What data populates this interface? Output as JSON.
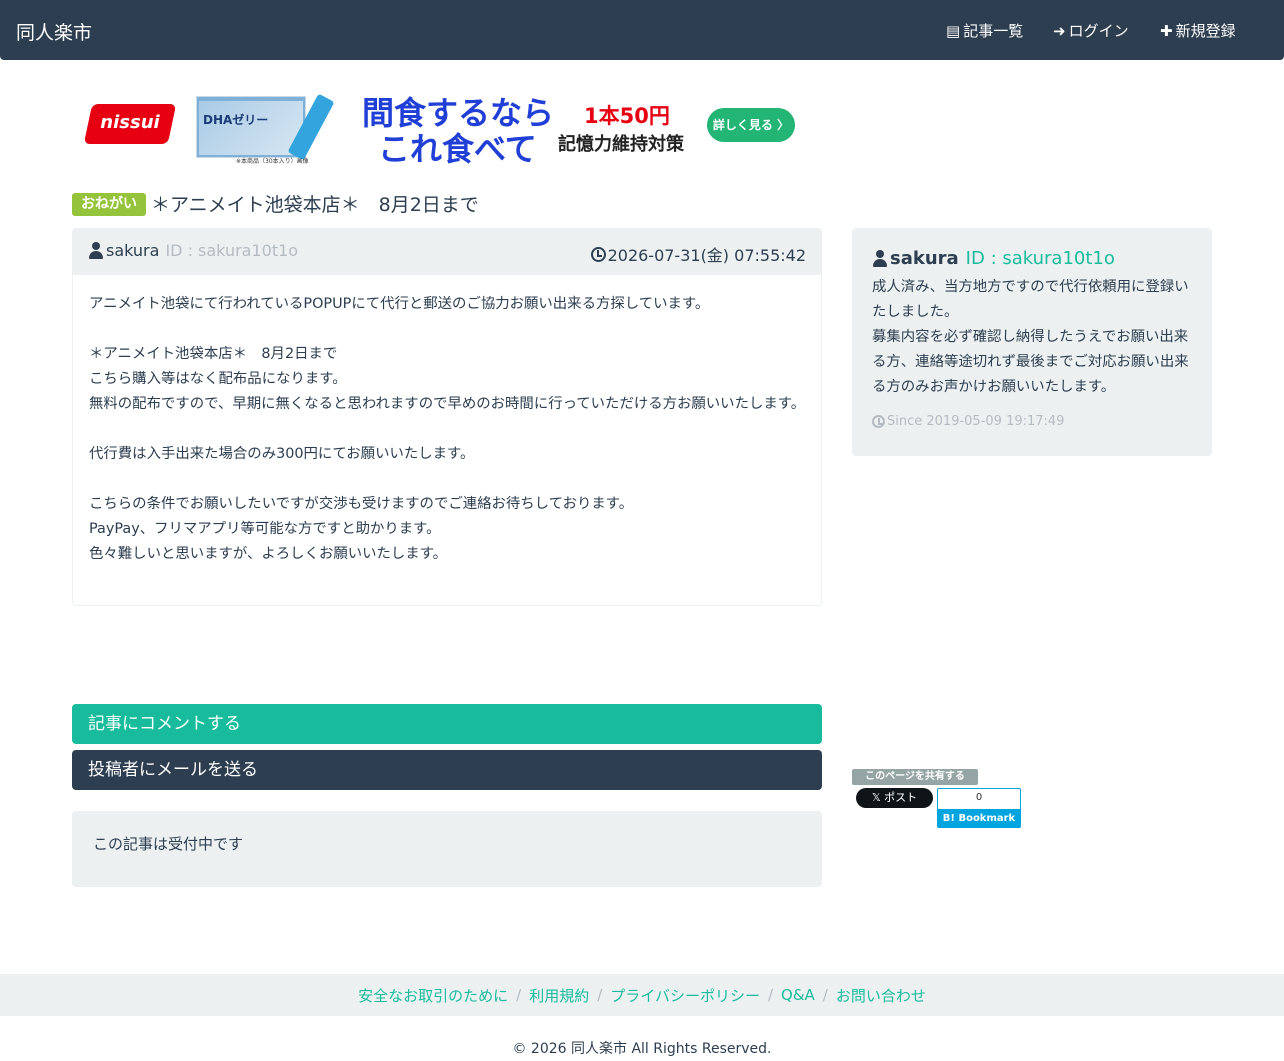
{
  "navbar": {
    "brand": "同人楽市",
    "links": [
      {
        "icon": "list-icon",
        "label": "記事一覧"
      },
      {
        "icon": "login-icon",
        "label": "ログイン"
      },
      {
        "icon": "plus-icon",
        "label": "新規登録"
      }
    ]
  },
  "ad": {
    "logo": "nissui",
    "product_label": "DHAゼリー",
    "caption": "※本商品（30本入り）画像",
    "headline_1": "間食するなら",
    "headline_2": "これ食べて",
    "price": "1本50円",
    "subtitle": "記憶力維持対策",
    "button": "詳しく見る 〉"
  },
  "post": {
    "badge": "おねがい",
    "title": "＊アニメイト池袋本店＊　8月2日まで",
    "author_name": "sakura",
    "author_id": "ID : sakura10t1o",
    "date": "2026-07-31(金) 07:55:42",
    "body": [
      "アニメイト池袋にて行われているPOPUPにて代行と郵送のご協力お願い出来る方探しています。",
      "",
      "＊アニメイト池袋本店＊　8月2日まで",
      "こちら購入等はなく配布品になります。",
      "無料の配布ですので、早期に無くなると思われますので早めのお時間に行っていただける方お願いいたします。",
      "",
      "代行費は入手出来た場合のみ300円にてお願いいたします。",
      "",
      "こちらの条件でお願いしたいですが交渉も受けますのでご連絡お待ちしております。",
      "PayPay、フリマアプリ等可能な方ですと助かります。",
      "色々難しいと思いますが、よろしくお願いいたします。"
    ]
  },
  "actions": {
    "comment": "記事にコメントする",
    "mail": "投稿者にメールを送る",
    "status": "この記事は受付中です"
  },
  "profile": {
    "name": "sakura",
    "id": "ID : sakura10t1o",
    "bio": "成人済み、当方地方ですので代行依頼用に登録いたしました。\n募集内容を必ず確認し納得したうえでお願い出来る方、連絡等途切れず最後までご対応お願い出来る方のみお声かけお願いいたします。",
    "since": "Since 2019-05-09 19:17:49"
  },
  "share": {
    "label": "このページを共有する",
    "x_post": "𝕏 ポスト",
    "hatena_count": "0",
    "hatena_button": "B! Bookmark"
  },
  "footer": {
    "links": [
      "安全なお取引のために",
      "利用規約",
      "プライバシーポリシー",
      "Q&A",
      "お問い合わせ"
    ],
    "copyright": "© 2026 同人楽市 All Rights Reserved."
  },
  "colors": {
    "navbar": "#2c3e50",
    "accent": "#18bc9c",
    "badge": "#95c33b",
    "well": "#ecf0f1",
    "muted": "#b4bcc2"
  }
}
